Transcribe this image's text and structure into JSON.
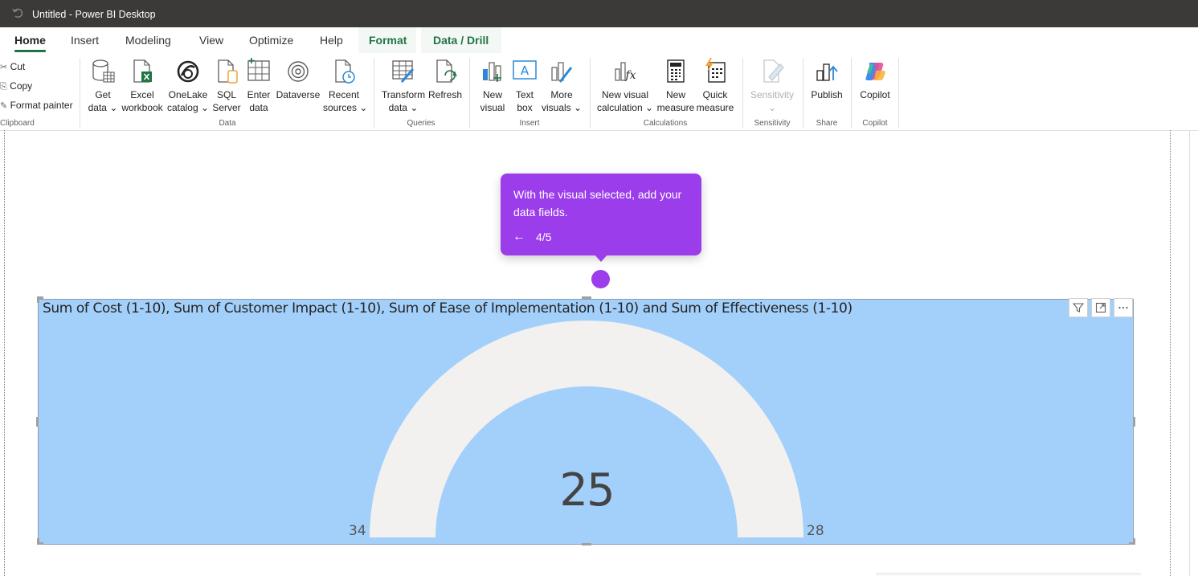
{
  "window": {
    "title": "Untitled - Power BI Desktop"
  },
  "tabs": [
    {
      "label": "Home"
    },
    {
      "label": "Insert"
    },
    {
      "label": "Modeling"
    },
    {
      "label": "View"
    },
    {
      "label": "Optimize"
    },
    {
      "label": "Help"
    },
    {
      "label": "Format"
    },
    {
      "label": "Data / Drill"
    }
  ],
  "clipboard": {
    "cut": "Cut",
    "copy": "Copy",
    "format_painter": "Format painter",
    "group": "Clipboard"
  },
  "ribbon": {
    "get_data": [
      "Get",
      "data ⌄"
    ],
    "excel": [
      "Excel",
      "workbook"
    ],
    "onelake": [
      "OneLake",
      "catalog ⌄"
    ],
    "sql": [
      "SQL",
      "Server"
    ],
    "enter": [
      "Enter",
      "data"
    ],
    "dataverse": [
      "Dataverse"
    ],
    "recent": [
      "Recent",
      "sources ⌄"
    ],
    "data_group": "Data",
    "transform": [
      "Transform",
      "data ⌄"
    ],
    "refresh": [
      "Refresh"
    ],
    "queries_group": "Queries",
    "new_visual": [
      "New",
      "visual"
    ],
    "text_box": [
      "Text",
      "box"
    ],
    "more_visuals": [
      "More",
      "visuals ⌄"
    ],
    "insert_group": "Insert",
    "new_visual_calc": [
      "New visual",
      "calculation ⌄"
    ],
    "new_measure": [
      "New",
      "measure"
    ],
    "quick_measure": [
      "Quick",
      "measure"
    ],
    "calculations_group": "Calculations",
    "sensitivity": [
      "Sensitivity",
      "⌄"
    ],
    "sensitivity_group": "Sensitivity",
    "publish": [
      "Publish"
    ],
    "share_group": "Share",
    "copilot": [
      "Copilot"
    ],
    "copilot_group": "Copilot"
  },
  "tooltip": {
    "text": "With the visual selected, add your data fields.",
    "back": "←",
    "step": "4/5"
  },
  "visual": {
    "title": "Sum of Cost (1-10), Sum of Customer Impact (1-10), Sum of Ease of Implementation (1-10) and Sum of Effectiveness (1-10)",
    "filter_icon": "filter-icon",
    "focus_icon": "focus-mode-icon",
    "more_icon": "more-options-icon"
  },
  "chart_data": {
    "type": "gauge",
    "value": 25,
    "min": 34,
    "max": 28,
    "fill_fraction": 0
  },
  "colors": {
    "titlebar": "#3b3a39",
    "accent": "#217346",
    "visual_bg": "#a3d0fb",
    "gauge_track": "#f2f1f0",
    "tooltip": "#9b3dea"
  }
}
